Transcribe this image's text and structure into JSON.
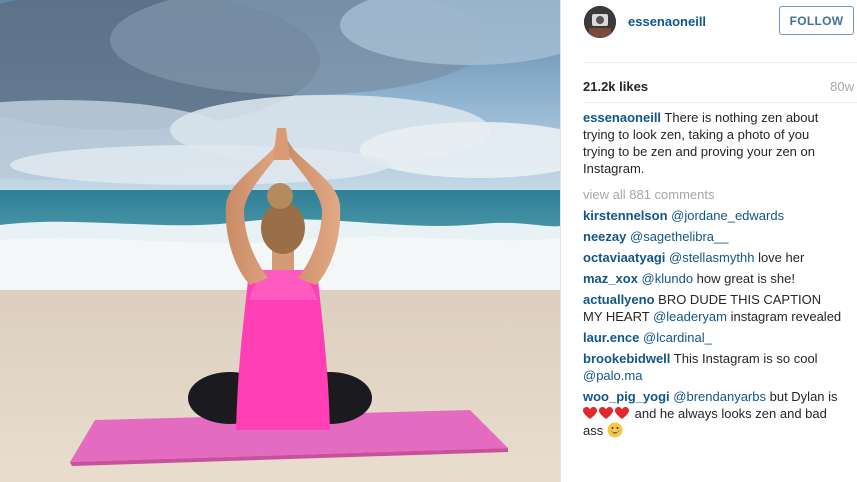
{
  "post": {
    "username": "essenaoneill",
    "follow_label": "FOLLOW",
    "likes": "21.2k likes",
    "age": "80w",
    "caption_user": "essenaoneill",
    "caption_text": " There is nothing zen about trying to look zen, taking a photo of you trying to be zen and proving your zen on Instagram.",
    "view_all": "view all 881 comments"
  },
  "comments": [
    {
      "user": "kirstennelson",
      "mention": "@jordane_edwards",
      "text": ""
    },
    {
      "user": "neezay",
      "mention": "@sagethelibra__",
      "text": ""
    },
    {
      "user": "octaviaatyagi",
      "mention": "@stellasmythh",
      "text": " love her"
    },
    {
      "user": "maz_xox",
      "mention": "@klundo",
      "text": " how great is she!"
    },
    {
      "user": "actuallyeno",
      "text_before": " BRO DUDE THIS CAPTION MY HEART ",
      "mention": "@leaderyam",
      "text": " instagram revealed"
    },
    {
      "user": "laur.ence",
      "mention": "@lcardinal_",
      "text": ""
    },
    {
      "user": "brookebidwell",
      "text_before": " This Instagram is so cool ",
      "mention": "@palo.ma",
      "text": ""
    },
    {
      "user": "woo_pig_yogi",
      "mention": "@brendanyarbs",
      "text_before_hearts": " but Dylan is ",
      "text_after_hearts": " and he always looks zen and bad ass "
    }
  ],
  "icons": {
    "heart": "red-heart-emoji",
    "smile": "grinning-face-emoji",
    "avatar": "profile-avatar"
  },
  "colors": {
    "link": "#125688",
    "muted": "#a5a7aa",
    "follow_border": "#6e99c2",
    "follow_text": "#3f729b",
    "heart": "#e0282e"
  }
}
